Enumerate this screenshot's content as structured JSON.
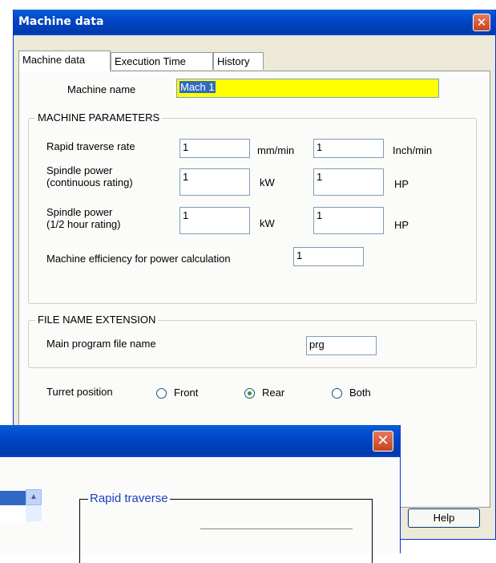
{
  "window": {
    "title": "Machine data",
    "tabs": [
      "Machine data",
      "Execution Time",
      "History"
    ],
    "machine_name_label": "Machine name",
    "machine_name_value": "Mach 1",
    "params": {
      "legend": "MACHINE PARAMETERS",
      "rapid_label": "Rapid traverse rate",
      "rapid_value1": "1",
      "rapid_unit1": "mm/min",
      "rapid_value2": "1",
      "rapid_unit2": "Inch/min",
      "spindle_cont_label1": "Spindle power",
      "spindle_cont_label2": "(continuous rating)",
      "spindle_cont_value1": "1",
      "spindle_cont_unit1": "kW",
      "spindle_cont_value2": "1",
      "spindle_cont_unit2": "HP",
      "spindle_half_label1": "Spindle power",
      "spindle_half_label2": "(1/2 hour rating)",
      "spindle_half_value1": "1",
      "spindle_half_unit1": "kW",
      "spindle_half_value2": "1",
      "spindle_half_unit2": "HP",
      "efficiency_label": "Machine efficiency for power calculation",
      "efficiency_value": "1"
    },
    "file_ext": {
      "legend": "FILE NAME EXTENSION",
      "main_label": "Main program file name",
      "main_value": "prg"
    },
    "turret": {
      "label": "Turret position",
      "options": [
        "Front",
        "Rear",
        "Both"
      ],
      "selected": "Rear"
    },
    "help_label": "Help",
    "close_glyph": "✕"
  },
  "window2": {
    "close_glyph": "✕",
    "group_legend": "Rapid traverse",
    "scroll_up_glyph": "▲"
  },
  "colors": {
    "titlebar": "#0047c8",
    "highlight_field": "#ffff00",
    "selection": "#316ac5",
    "legend_blue": "#1a40c6"
  }
}
